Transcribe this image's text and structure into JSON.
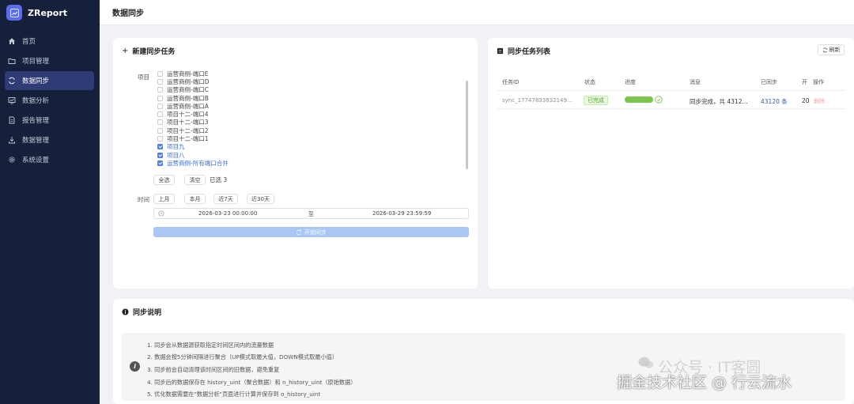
{
  "app": {
    "name": "ZReport"
  },
  "sidebar": {
    "items": [
      {
        "label": "首页",
        "icon": "home-icon"
      },
      {
        "label": "项目管理",
        "icon": "folder-icon"
      },
      {
        "label": "数据同步",
        "icon": "sync-icon",
        "active": true
      },
      {
        "label": "数据分析",
        "icon": "chart-icon"
      },
      {
        "label": "报告管理",
        "icon": "document-icon"
      },
      {
        "label": "数据管理",
        "icon": "download-icon"
      },
      {
        "label": "系统设置",
        "icon": "gear-icon"
      }
    ]
  },
  "header": {
    "title": "数据同步"
  },
  "new_task": {
    "title": "新建同步任务",
    "project_label": "项目",
    "projects": [
      {
        "label": "运营商侧-端口E",
        "checked": false
      },
      {
        "label": "运营商侧-端口D",
        "checked": false
      },
      {
        "label": "运营商侧-端口C",
        "checked": false
      },
      {
        "label": "运营商侧-端口B",
        "checked": false
      },
      {
        "label": "运营商侧-端口A",
        "checked": false
      },
      {
        "label": "项目十二-端口4",
        "checked": false
      },
      {
        "label": "项目十二-端口3",
        "checked": false
      },
      {
        "label": "项目十二-端口2",
        "checked": false
      },
      {
        "label": "项目十二-端口1",
        "checked": false
      },
      {
        "label": "项目九",
        "checked": true
      },
      {
        "label": "项目八",
        "checked": true
      },
      {
        "label": "运营商侧-所有端口合并",
        "checked": true
      }
    ],
    "select_all": "全选",
    "clear": "清空",
    "selected_count": "已选 3",
    "time_label": "时间",
    "quick_ranges": [
      "上月",
      "本月",
      "近7天",
      "近30天"
    ],
    "start_time": "2026-03-23 00:00:00",
    "range_separator": "至",
    "end_time": "2026-03-29 23:59:59",
    "start_button": "开始同步"
  },
  "task_list": {
    "title": "同步任务列表",
    "refresh": "刷新",
    "columns": [
      "任务ID",
      "状态",
      "进度",
      "消息",
      "已同步",
      "开",
      "操作"
    ],
    "rows": [
      {
        "id": "sync_17747833832149...",
        "status": "已完成",
        "progress": 1.0,
        "message": "同步完成，共 4312...",
        "synced": "43120 条",
        "started": "20",
        "action": "删除"
      }
    ]
  },
  "notes": {
    "title": "同步说明",
    "items": [
      "1. 同步会从数据源获取指定时间区间内的流量数据",
      "2. 数据会按5分钟间隔进行聚合（UP模式取最大值，DOWN模式取最小值）",
      "3. 同步前会自动清理该时间区间的旧数据，避免重复",
      "4. 同步后的数据保存在 history_uint（聚合数据）和 n_history_uint（原始数据）",
      "5. 优化数据需要在\"数据分析\"页面进行计算并保存到 o_history_uint"
    ]
  },
  "watermark": {
    "line1": "公众号 · IT客圆",
    "line2": "掘金技术社区 @ 行云流水"
  },
  "colors": {
    "sidebar_bg": "#17203a",
    "accent": "#4d80e6",
    "success": "#7bc74d"
  }
}
